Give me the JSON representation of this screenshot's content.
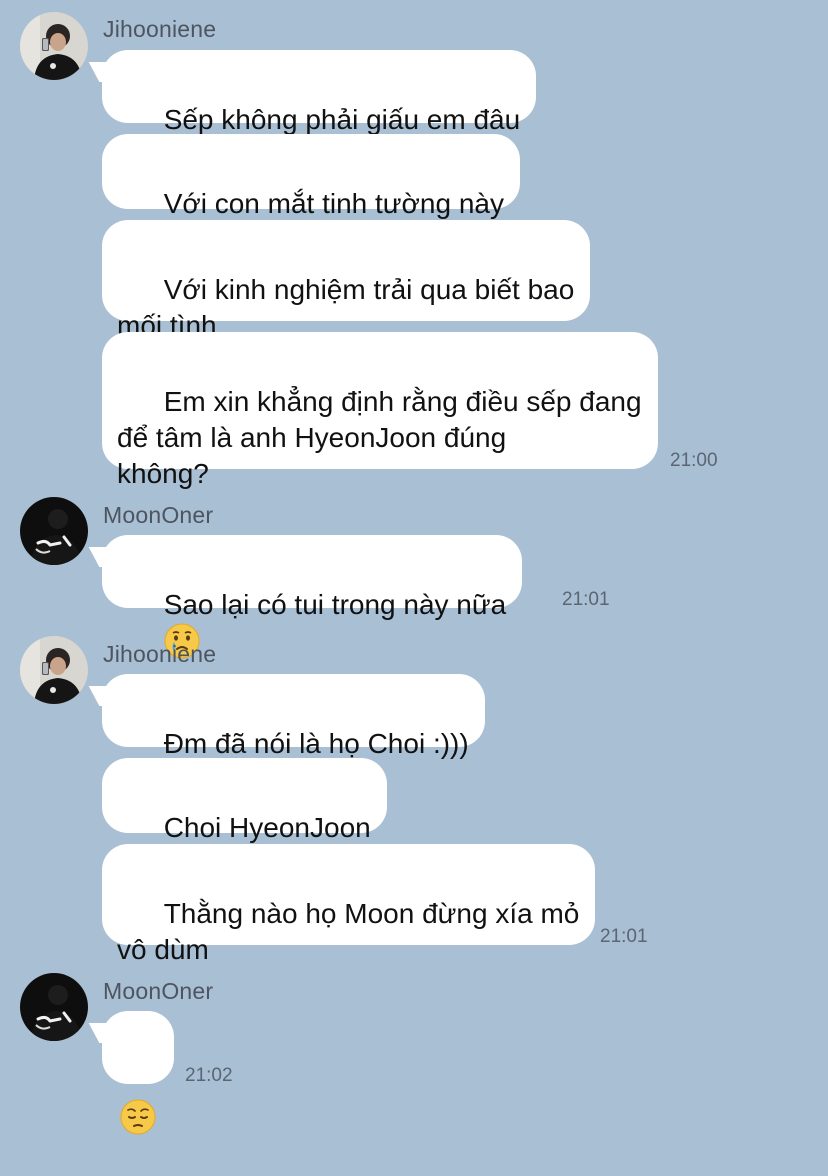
{
  "colors": {
    "background": "#a9bfd4",
    "bubble": "#ffffff",
    "sender_text": "#4d5560",
    "time_text": "#5a6673"
  },
  "groups": [
    {
      "sender": "Jihooniene",
      "avatar_icon": "avatar-jihooniene-icon",
      "messages": [
        "Sếp không phải giấu em đâu",
        "Với con mắt tinh tường này",
        "Với kinh nghiệm trải qua biết bao\nmối tình",
        "Em xin khẳng định rằng điều sếp đang\nđể tâm là anh HyeonJoon đúng\nkhông?"
      ],
      "time": "21:00"
    },
    {
      "sender": "MoonOner",
      "avatar_icon": "avatar-moononer-icon",
      "messages": [
        "Sao lại có tui trong này nữa"
      ],
      "emoji": "crying-face-icon",
      "time": "21:01"
    },
    {
      "sender": "Jihooniene",
      "avatar_icon": "avatar-jihooniene-icon",
      "messages": [
        "Đm đã nói là họ Choi :)))",
        "Choi HyeonJoon",
        "Thằng nào họ Moon đừng xía mỏ\nvô dùm"
      ],
      "time": "21:01"
    },
    {
      "sender": "MoonOner",
      "avatar_icon": "avatar-moononer-icon",
      "messages": [],
      "emoji": "pensive-face-icon",
      "time": "21:02"
    }
  ]
}
